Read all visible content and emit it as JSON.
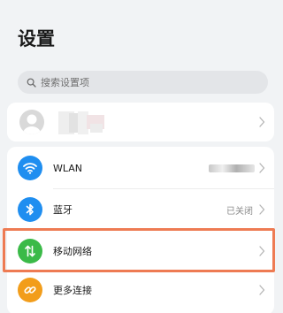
{
  "page": {
    "title": "设置"
  },
  "search": {
    "placeholder": "搜索设置项",
    "icon": "search-icon"
  },
  "account": {
    "icon": "avatar-icon"
  },
  "items": [
    {
      "label": "WLAN",
      "status": "",
      "icon": "wifi-icon",
      "color": "#1f8ef0"
    },
    {
      "label": "蓝牙",
      "status": "已关闭",
      "icon": "bluetooth-icon",
      "color": "#1f8ef0"
    },
    {
      "label": "移动网络",
      "status": "",
      "icon": "mobile-data-icon",
      "color": "#3bba48"
    },
    {
      "label": "更多连接",
      "status": "",
      "icon": "link-icon",
      "color": "#f29d1b"
    }
  ],
  "highlight_color": "#ee7b53"
}
